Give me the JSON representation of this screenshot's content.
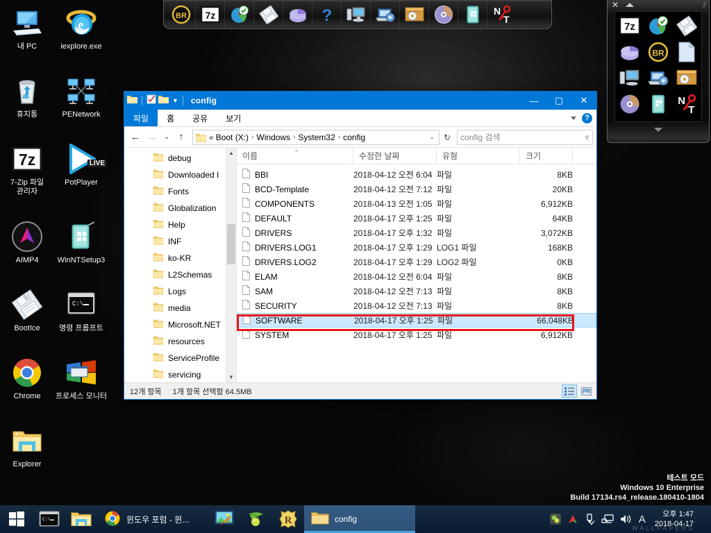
{
  "desktop": {
    "icons": [
      {
        "label": "내 PC",
        "icon": "computer-icon"
      },
      {
        "label": "iexplore.exe",
        "icon": "internet-explorer-icon"
      },
      {
        "label": "휴지통",
        "icon": "recycle-bin-icon"
      },
      {
        "label": "PENetwork",
        "icon": "network-nodes-icon"
      },
      {
        "label": "7-Zip 파일 관리자",
        "icon": "seven-zip-icon"
      },
      {
        "label": "PotPlayer",
        "icon": "potplayer-icon"
      },
      {
        "label": "AIMP4",
        "icon": "aimp-icon"
      },
      {
        "label": "WinNTSetup3",
        "icon": "winntsetup-icon"
      },
      {
        "label": "BootIce",
        "icon": "bootice-floppy-icon"
      },
      {
        "label": "명령 프롬프트",
        "icon": "command-prompt-icon"
      },
      {
        "label": "Chrome",
        "icon": "chrome-icon"
      },
      {
        "label": "프로세스 모니터",
        "icon": "process-monitor-icon"
      },
      {
        "label": "Explorer",
        "icon": "folder-icon"
      }
    ],
    "potplayer_badge": "LIVE",
    "watermark": {
      "line1": "테스트 모드",
      "line2": "Windows 10 Enterprise",
      "line3": "Build 17134.rs4_release.180410-1804"
    }
  },
  "top_dock": {
    "items": [
      {
        "icon": "br-badge-icon",
        "label": "BR"
      },
      {
        "icon": "seven-zip-icon",
        "label": "7z"
      },
      {
        "icon": "partition-wizard-icon",
        "label": "파티션 마법사"
      },
      {
        "icon": "floppy-disk-icon",
        "label": "BootIce"
      },
      {
        "icon": "pie-disk-icon",
        "label": "디스크 관리"
      },
      {
        "icon": "question-help-icon",
        "label": "도움말"
      },
      {
        "icon": "computer-tower-icon",
        "label": "내 컴퓨터"
      },
      {
        "icon": "laptop-gear-icon",
        "label": "시스템 설정"
      },
      {
        "icon": "archive-box-icon",
        "label": "백업"
      },
      {
        "icon": "cd-disc-icon",
        "label": "CD/DVD"
      },
      {
        "icon": "teal-book-icon",
        "label": "설정"
      },
      {
        "icon": "nt-key-icon",
        "label": "NT 암호 도구"
      }
    ]
  },
  "launcher_panel": {
    "close_label": "✕",
    "items": [
      {
        "icon": "seven-zip-icon"
      },
      {
        "icon": "partition-wizard-icon"
      },
      {
        "icon": "floppy-disk-icon"
      },
      {
        "icon": "pie-disk-icon"
      },
      {
        "icon": "br-badge-icon"
      },
      {
        "icon": "blank-document-icon"
      },
      {
        "icon": "computer-tower-icon"
      },
      {
        "icon": "laptop-gear-icon"
      },
      {
        "icon": "archive-box-icon"
      },
      {
        "icon": "cd-disc-icon"
      },
      {
        "icon": "teal-book-icon"
      },
      {
        "icon": "nt-key-icon"
      }
    ]
  },
  "explorer": {
    "title": "config",
    "window_buttons": {
      "minimize": "—",
      "maximize": "▢",
      "close": "✕"
    },
    "ribbon_tabs": [
      {
        "label": "파일",
        "active": true
      },
      {
        "label": "홈",
        "active": false
      },
      {
        "label": "공유",
        "active": false
      },
      {
        "label": "보기",
        "active": false
      }
    ],
    "help_label": "?",
    "nav": {
      "back": "←",
      "forward": "→",
      "recent": "⌄",
      "up": "↑"
    },
    "address": {
      "lead": "«",
      "crumbs": [
        "Boot (X:)",
        "Windows",
        "System32",
        "config"
      ],
      "dropdown": "⌄",
      "refresh": "↻"
    },
    "search": {
      "placeholder": "config 검색",
      "icon": "search-icon"
    },
    "tree_items": [
      "debug",
      "Downloaded I",
      "Fonts",
      "Globalization",
      "Help",
      "INF",
      "ko-KR",
      "L2Schemas",
      "Logs",
      "media",
      "Microsoft.NET",
      "resources",
      "ServiceProfile",
      "servicing"
    ],
    "columns": [
      "이름",
      "수정한 날짜",
      "유형",
      "크기"
    ],
    "sort_indicator": "^",
    "files": [
      {
        "name": "BBI",
        "modified": "2018-04-12 오전 6:04",
        "type": "파일",
        "size": "8KB",
        "selected": false
      },
      {
        "name": "BCD-Template",
        "modified": "2018-04-12 오전 7:12",
        "type": "파일",
        "size": "20KB",
        "selected": false
      },
      {
        "name": "COMPONENTS",
        "modified": "2018-04-13 오전 1:05",
        "type": "파일",
        "size": "6,912KB",
        "selected": false
      },
      {
        "name": "DEFAULT",
        "modified": "2018-04-17 오후 1:25",
        "type": "파일",
        "size": "64KB",
        "selected": false
      },
      {
        "name": "DRIVERS",
        "modified": "2018-04-17 오후 1:32",
        "type": "파일",
        "size": "3,072KB",
        "selected": false
      },
      {
        "name": "DRIVERS.LOG1",
        "modified": "2018-04-17 오후 1:29",
        "type": "LOG1 파일",
        "size": "168KB",
        "selected": false
      },
      {
        "name": "DRIVERS.LOG2",
        "modified": "2018-04-17 오후 1:29",
        "type": "LOG2 파일",
        "size": "0KB",
        "selected": false
      },
      {
        "name": "ELAM",
        "modified": "2018-04-12 오전 6:04",
        "type": "파일",
        "size": "8KB",
        "selected": false
      },
      {
        "name": "SAM",
        "modified": "2018-04-12 오전 7:13",
        "type": "파일",
        "size": "8KB",
        "selected": false
      },
      {
        "name": "SECURITY",
        "modified": "2018-04-12 오전 7:13",
        "type": "파일",
        "size": "8KB",
        "selected": false
      },
      {
        "name": "SOFTWARE",
        "modified": "2018-04-17 오후 1:25",
        "type": "파일",
        "size": "66,048KB",
        "selected": true
      },
      {
        "name": "SYSTEM",
        "modified": "2018-04-17 오후 1:25",
        "type": "파일",
        "size": "6,912KB",
        "selected": false
      }
    ],
    "status": {
      "item_count": "12개 항목",
      "selection": "1개 항목 선택함 64.5MB"
    },
    "view_toggles": [
      {
        "name": "details-view",
        "active": true
      },
      {
        "name": "large-icons-view",
        "active": false
      }
    ],
    "highlight_color": "#e8141b"
  },
  "taskbar": {
    "start_label": "시작",
    "pinned": [
      {
        "icon": "command-prompt-icon",
        "label": "명령 프롬프트"
      },
      {
        "icon": "file-explorer-icon",
        "label": "파일 탐색기"
      }
    ],
    "tasks": [
      {
        "icon": "chrome-icon",
        "label": "윈도우 포럼 - 윈...",
        "active": false
      },
      {
        "icon": "paint-icon",
        "label": "그림판",
        "active": false
      },
      {
        "icon": "olive-icon",
        "label": "Olive",
        "active": false
      },
      {
        "icon": "r-shield-icon",
        "label": "R",
        "active": false
      },
      {
        "icon": "folder-icon",
        "label": "config",
        "active": true
      }
    ],
    "tray": [
      {
        "icon": "green-app-icon"
      },
      {
        "icon": "aimp-tray-icon"
      },
      {
        "icon": "usb-eject-icon"
      },
      {
        "icon": "network-icon"
      },
      {
        "icon": "volume-icon"
      },
      {
        "icon": "ime-a-icon",
        "label": "A"
      }
    ],
    "clock": {
      "time": "오후 1:47",
      "date": "2018-04-17"
    },
    "ghost_text": "WALLPAPERS"
  }
}
